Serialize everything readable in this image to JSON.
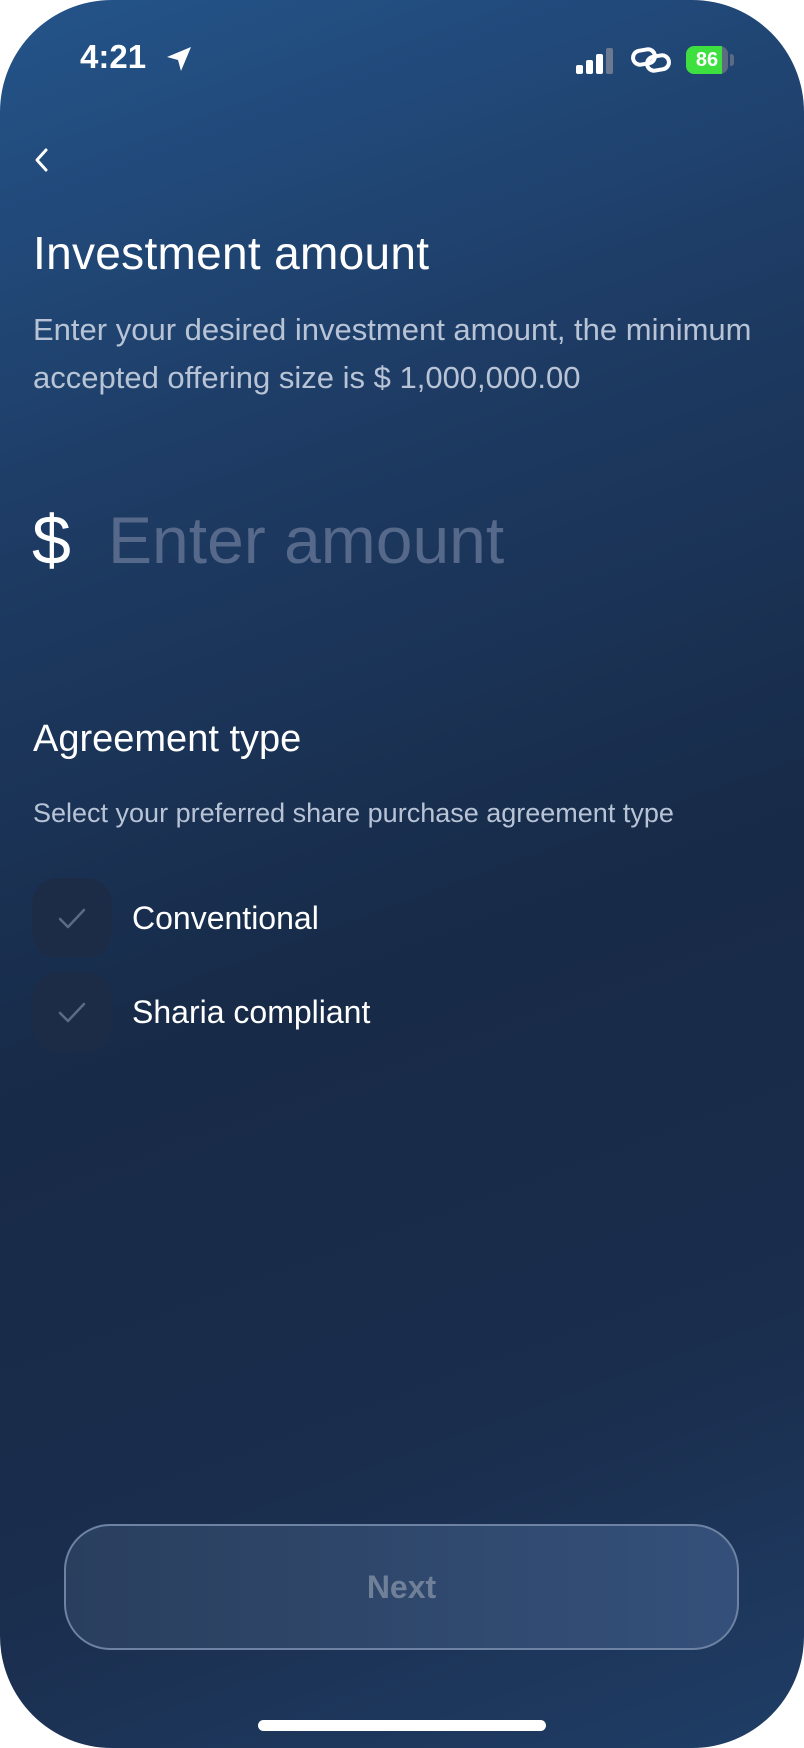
{
  "status_bar": {
    "time": "4:21",
    "battery_level": "86",
    "battery_fraction": 0.86,
    "icons": [
      "location-arrow-icon",
      "cellular-signal-icon",
      "link-icon",
      "battery-icon"
    ]
  },
  "header": {
    "back_icon": "chevron-left-icon",
    "title": "Investment amount",
    "subtitle": "Enter your desired investment amount, the minimum accepted offering size is $ 1,000,000.00"
  },
  "amount": {
    "currency_symbol": "$",
    "value": "",
    "placeholder": "Enter amount"
  },
  "agreement": {
    "title": "Agreement type",
    "subtitle": "Select your preferred share purchase agreement type",
    "options": [
      {
        "label": "Conventional",
        "checked": false,
        "icon": "checkmark-icon"
      },
      {
        "label": "Sharia compliant",
        "checked": false,
        "icon": "checkmark-icon"
      }
    ]
  },
  "footer": {
    "next_label": "Next"
  },
  "colors": {
    "background_top": "#24548a",
    "background_mid": "#172a47",
    "battery_green": "#3ee03f",
    "placeholder": "#56698a"
  }
}
